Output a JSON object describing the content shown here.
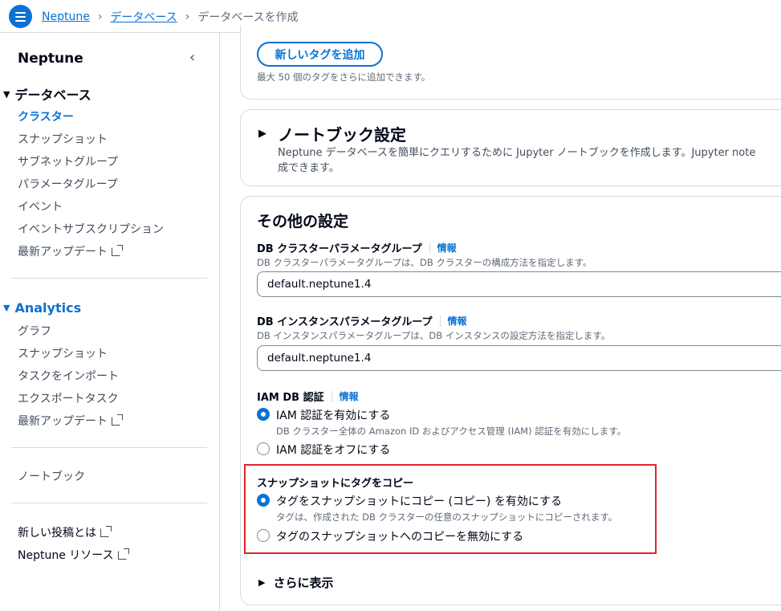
{
  "breadcrumb": {
    "items": [
      "Neptune",
      "データベース"
    ],
    "current": "データベースを作成"
  },
  "sidebar": {
    "title": "Neptune",
    "database_section": "データベース",
    "database_items": [
      "クラスター",
      "スナップショット",
      "サブネットグループ",
      "パラメータグループ",
      "イベント",
      "イベントサブスクリプション",
      "最新アップデート"
    ],
    "analytics_section": "Analytics",
    "analytics_items": [
      "グラフ",
      "スナップショット",
      "タスクをインポート",
      "エクスポートタスク",
      "最新アップデート"
    ],
    "notebook": "ノートブック",
    "whats_new": "新しい投稿とは",
    "resources": "Neptune リソース"
  },
  "tags": {
    "add_button": "新しいタグを追加",
    "hint": "最大 50 個のタグをさらに追加できます。"
  },
  "notebook": {
    "title": "ノートブック設定",
    "description": "Neptune データベースを簡単にクエリするために Jupyter ノートブックを作成します。Jupyter note",
    "description2": "成できます。"
  },
  "other": {
    "title": "その他の設定",
    "cluster_pg_label": "DB クラスターパラメータグループ",
    "info": "情報",
    "cluster_pg_desc": "DB クラスターパラメータグループは、DB クラスターの構成方法を指定します。",
    "cluster_pg_value": "default.neptune1.4",
    "instance_pg_label": "DB インスタンスパラメータグループ",
    "instance_pg_desc": "DB インスタンスパラメータグループは、DB インスタンスの設定方法を指定します。",
    "instance_pg_value": "default.neptune1.4",
    "iam_label": "IAM DB 認証",
    "iam_on": "IAM 認証を有効にする",
    "iam_on_desc": "DB クラスター全体の Amazon ID およびアクセス管理 (IAM) 認証を有効にします。",
    "iam_off": "IAM 認証をオフにする",
    "copy_tags_label": "スナップショットにタグをコピー",
    "copy_on": "タグをスナップショットにコピー (コピー) を有効にする",
    "copy_on_desc": "タグは、作成された DB クラスターの任意のスナップショットにコピーされます。",
    "copy_off": "タグのスナップショットへのコピーを無効にする",
    "show_more": "さらに表示"
  },
  "colors": {
    "accent": "#0972d3",
    "highlight": "#e0242b"
  }
}
